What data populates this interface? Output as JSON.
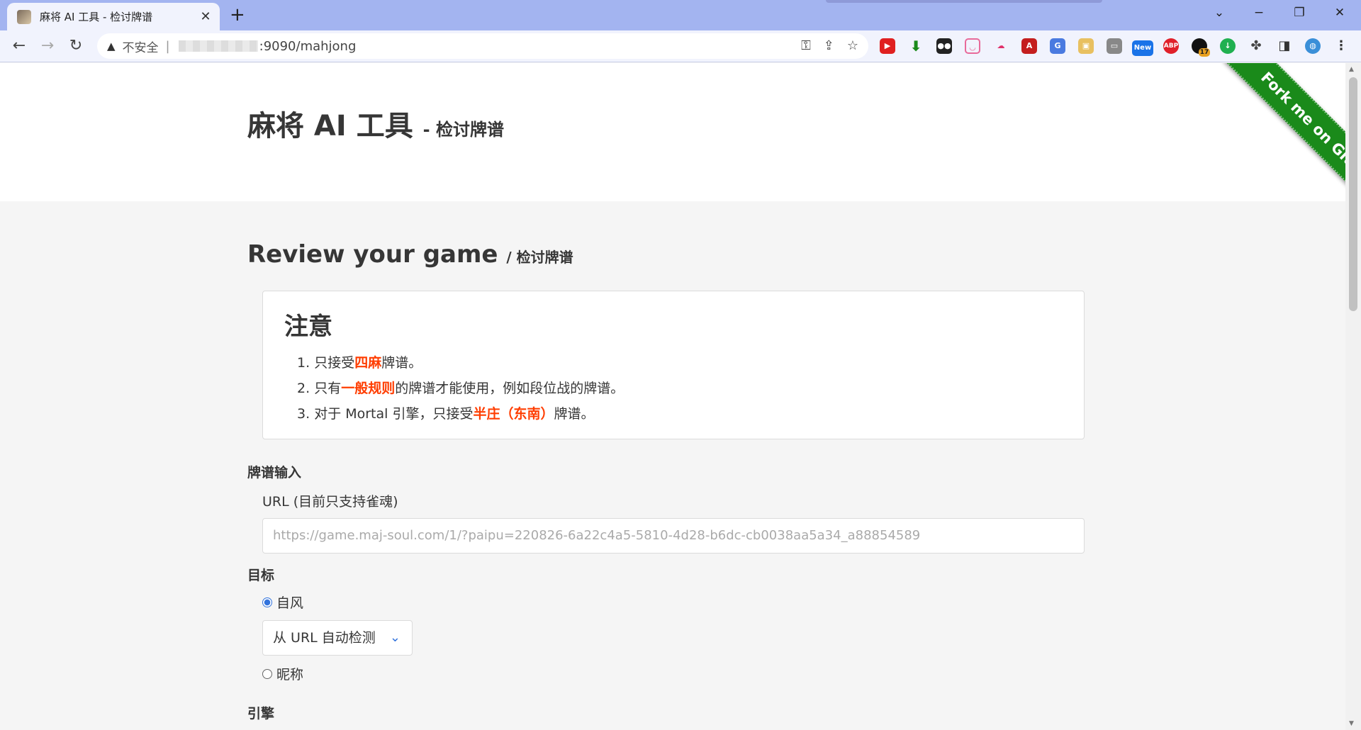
{
  "browser": {
    "tab_title": "麻将 AI 工具 - 检讨牌谱",
    "tab_close": "✕",
    "new_tab": "+",
    "security_warning": "不安全",
    "url": ":9090/mahjong",
    "ext_new_badge": "New",
    "ext_count_badge": "17",
    "ext_abp": "ABP"
  },
  "hero": {
    "title": "麻将 AI 工具",
    "subtitle": "- 检讨牌谱"
  },
  "ribbon": {
    "label": "Fork me on GitHub"
  },
  "section": {
    "title": "Review your game",
    "subtitle": "/ 检讨牌谱"
  },
  "notice": {
    "heading": "注意",
    "items": [
      {
        "num": "1.",
        "pre": "只接受",
        "hl": "四麻",
        "post": "牌谱。"
      },
      {
        "num": "2.",
        "pre": "只有",
        "hl": "一般规则",
        "post": "的牌谱才能使用，例如段位战的牌谱。"
      },
      {
        "num": "3.",
        "pre": "对于 Mortal 引擎，只接受",
        "hl": "半庄（东南）",
        "post": "牌谱。"
      }
    ]
  },
  "form": {
    "input_section": "牌谱输入",
    "url_label": "URL (目前只支持雀魂)",
    "url_placeholder": "https://game.maj-soul.com/1/?paipu=220826-6a22c4a5-5810-4d28-b6dc-cb0038aa5a34_a88854589",
    "target_label": "目标",
    "radio_seat": "自风",
    "seat_select": "从 URL 自动检测",
    "radio_nickname": "昵称",
    "engine_label": "引擎"
  },
  "colors": {
    "accent": "#3273dc",
    "highlight": "#ff3d00",
    "ribbon": "#1a8a1a"
  }
}
